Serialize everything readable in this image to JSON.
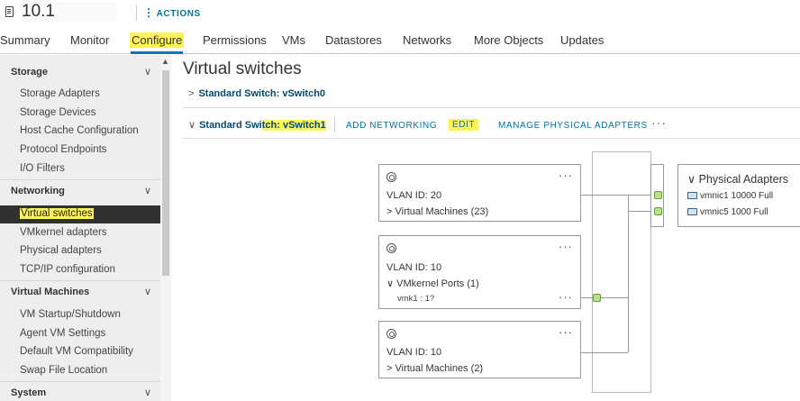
{
  "header": {
    "host_name": "10.1",
    "actions_label": "ACTIONS"
  },
  "tabs": [
    "Summary",
    "Monitor",
    "Configure",
    "Permissions",
    "VMs",
    "Datastores",
    "Networks",
    "More Objects",
    "Updates"
  ],
  "sidebar": {
    "storage": {
      "title": "Storage",
      "items": [
        "Storage Adapters",
        "Storage Devices",
        "Host Cache Configuration",
        "Protocol Endpoints",
        "I/O Filters"
      ]
    },
    "networking": {
      "title": "Networking",
      "items": [
        "Virtual switches",
        "VMkernel adapters",
        "Physical adapters",
        "TCP/IP configuration"
      ]
    },
    "virtual_machines": {
      "title": "Virtual Machines",
      "items": [
        "VM Startup/Shutdown",
        "Agent VM Settings",
        "Default VM Compatibility",
        "Swap File Location"
      ]
    },
    "system": {
      "title": "System"
    }
  },
  "main": {
    "title": "Virtual switches",
    "switch0": {
      "prefix": "Standard Switch: ",
      "name": "vSwitch0"
    },
    "switch1": {
      "prefix": "Standard Swi",
      "name_hl": "tch: vSwitch1"
    },
    "actions": {
      "add_networking": "ADD NETWORKING",
      "edit": "EDIT",
      "manage_adapters": "MANAGE PHYSICAL ADAPTERS",
      "more": "···"
    }
  },
  "diagram": {
    "port_groups": [
      {
        "vlan": "VLAN ID: 20",
        "sub": "Virtual Machines (23)",
        "expanded": false
      },
      {
        "vlan": "VLAN ID: 10",
        "sub": "VMkernel Ports (1)",
        "expanded": true,
        "vmk": "vmk1 : 1?"
      },
      {
        "vlan": "VLAN ID: 10",
        "sub": "Virtual Machines (2)",
        "expanded": false
      }
    ],
    "physical_adapters": {
      "title": "Physical Adapters",
      "items": [
        "vmnic1 10000 Full",
        "vmnic5 1000 Full"
      ]
    },
    "colors": {
      "port_fill": "#b8e08d",
      "highlight": "#fff35c",
      "accent": "#0072a3"
    }
  }
}
